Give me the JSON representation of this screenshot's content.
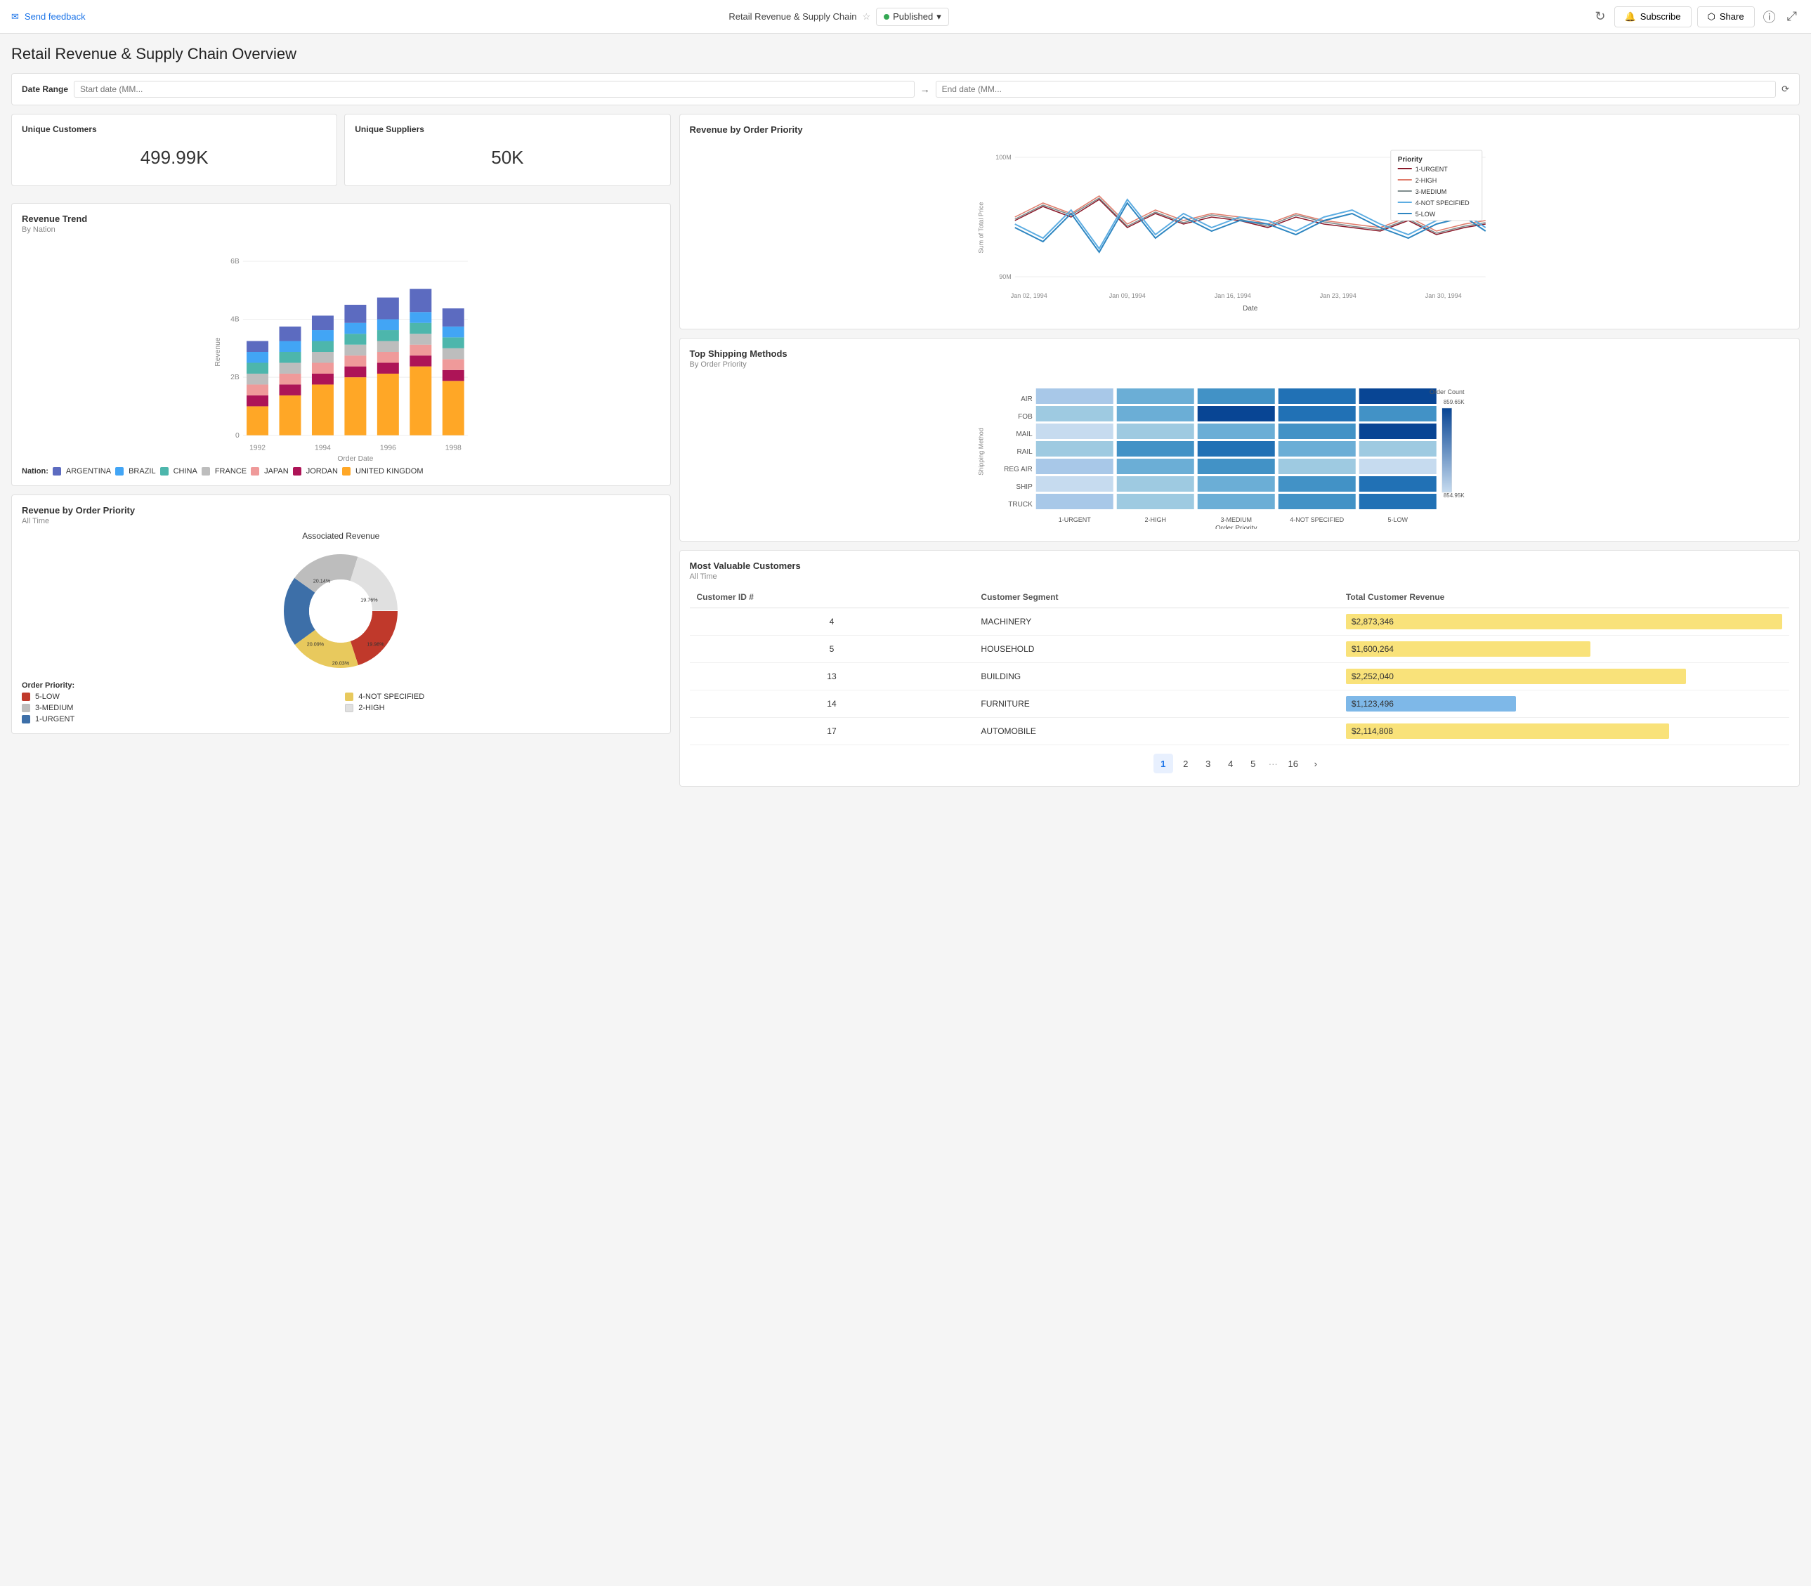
{
  "nav": {
    "feedback_label": "Send feedback",
    "title": "Retail Revenue & Supply Chain",
    "published_label": "Published",
    "subscribe_label": "Subscribe",
    "share_label": "Share"
  },
  "page": {
    "title": "Retail Revenue & Supply Chain Overview"
  },
  "date_range": {
    "label": "Date Range",
    "start_placeholder": "Start date (MM...",
    "end_placeholder": "End date (MM..."
  },
  "kpis": [
    {
      "label": "Unique Customers",
      "value": "499.99K"
    },
    {
      "label": "Unique Suppliers",
      "value": "50K"
    }
  ],
  "revenue_trend": {
    "title": "Revenue Trend",
    "subtitle": "By Nation",
    "y_labels": [
      "6B",
      "4B",
      "2B",
      "0"
    ],
    "x_labels": [
      "1992",
      "1994",
      "1996",
      "1998"
    ],
    "x_axis_label": "Order Date",
    "y_axis_label": "Revenue",
    "nations": [
      "ARGENTINA",
      "BRAZIL",
      "CHINA",
      "FRANCE",
      "JAPAN",
      "JORDAN",
      "UNITED KINGDOM"
    ],
    "colors": [
      "#5c6bc0",
      "#42a5f5",
      "#4db6ac",
      "#bdbdbd",
      "#ef9a9a",
      "#ad1457",
      "#ffa726"
    ]
  },
  "revenue_by_priority": {
    "title": "Revenue by Order Priority",
    "x_labels": [
      "Jan 02, 1994",
      "Jan 09, 1994",
      "Jan 16, 1994",
      "Jan 23, 1994",
      "Jan 30, 1994"
    ],
    "x_axis_label": "Date",
    "y_axis_label": "Sum of Total Price",
    "y_labels": [
      "100M",
      "90M"
    ],
    "priority_labels": [
      "1-URGENT",
      "2-HIGH",
      "3-MEDIUM",
      "4-NOT SPECIFIED",
      "5-LOW"
    ],
    "priority_colors": [
      "#c0392b",
      "#e07b6a",
      "#7f8c8d",
      "#5dade2",
      "#2e86c1"
    ]
  },
  "top_shipping": {
    "title": "Top Shipping Methods",
    "subtitle": "By Order Priority",
    "y_labels": [
      "AIR",
      "FOB",
      "MAIL",
      "RAIL",
      "REG AIR",
      "SHIP",
      "TRUCK"
    ],
    "x_labels": [
      "1-URGENT",
      "2-HIGH",
      "3-MEDIUM",
      "4-NOT SPECIFIED",
      "5-LOW"
    ],
    "y_axis_label": "Shipping Method",
    "x_axis_label": "Order Priority",
    "legend_title": "Order Count",
    "legend_max": "859.65K",
    "legend_min": "854.95K"
  },
  "revenue_priority_pie": {
    "title": "Revenue by Order Priority",
    "subtitle": "All Time",
    "chart_title": "Associated Revenue",
    "segments": [
      {
        "label": "5-LOW",
        "pct": "20.14%",
        "color": "#c0392b"
      },
      {
        "label": "4-NOT SPECIFIED",
        "pct": "19.76%",
        "color": "#e8c95d"
      },
      {
        "label": "3-MEDIUM",
        "pct": "19.98%",
        "color": "#bdbdbd"
      },
      {
        "label": "2-HIGH",
        "pct": "20.03%",
        "color": "#f5f5f5"
      },
      {
        "label": "1-URGENT",
        "pct": "20.09%",
        "color": "#3d6fa8"
      }
    ],
    "legend_labels": [
      "5-LOW",
      "4-NOT SPECIFIED",
      "3-MEDIUM",
      "2-HIGH",
      "1-URGENT"
    ],
    "legend_colors": [
      "#c0392b",
      "#e8c95d",
      "#bdbdbd",
      "#e0e0e0",
      "#3d6fa8"
    ],
    "pct_labels": [
      "20.14%",
      "19.76%",
      "20.09%",
      "19.98%",
      "20.03%"
    ]
  },
  "most_valuable": {
    "title": "Most Valuable Customers",
    "subtitle": "All Time",
    "col_headers": [
      "Customer ID #",
      "Customer Segment",
      "Total Customer Revenue"
    ],
    "rows": [
      {
        "id": "4",
        "segment": "MACHINERY",
        "revenue": "$2,873,346",
        "bar_pct": 100,
        "bar_color": "yellow"
      },
      {
        "id": "5",
        "segment": "HOUSEHOLD",
        "revenue": "$1,600,264",
        "bar_pct": 56,
        "bar_color": "yellow"
      },
      {
        "id": "13",
        "segment": "BUILDING",
        "revenue": "$2,252,040",
        "bar_pct": 78,
        "bar_color": "yellow"
      },
      {
        "id": "14",
        "segment": "FURNITURE",
        "revenue": "$1,123,496",
        "bar_pct": 39,
        "bar_color": "blue"
      },
      {
        "id": "17",
        "segment": "AUTOMOBILE",
        "revenue": "$2,114,808",
        "bar_pct": 74,
        "bar_color": "yellow"
      }
    ],
    "pagination": {
      "current": 1,
      "pages": [
        "1",
        "2",
        "3",
        "4",
        "5",
        "16"
      ],
      "dots": "···"
    }
  }
}
